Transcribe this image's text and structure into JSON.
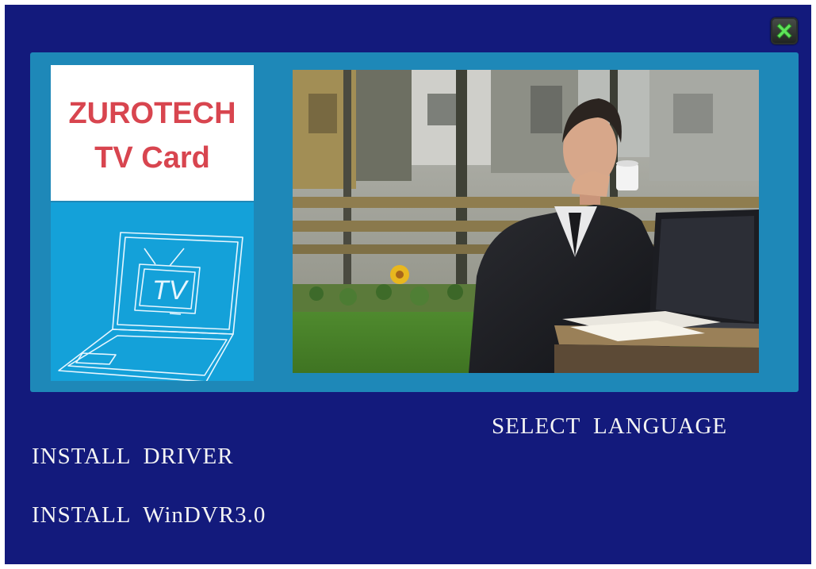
{
  "brand": {
    "line1": "ZUROTECH",
    "line2": "TV Card",
    "color": "#d8454f"
  },
  "laptop_illustration": {
    "screen_text": "TV"
  },
  "photo": {
    "subject": "businessman drinking coffee at laptop outdoors"
  },
  "menu": {
    "select_language": "SELECT  LANGUAGE",
    "install_driver": "INSTALL  DRIVER",
    "install_windvr": "INSTALL  WinDVR3.0"
  },
  "icons": {
    "close": "close-icon"
  },
  "colors": {
    "background": "#131a7c",
    "banner": "#1e88b8",
    "laptop_panel": "#14a1d9",
    "text": "#f4f4f4",
    "close_x": "#5fe45a"
  }
}
